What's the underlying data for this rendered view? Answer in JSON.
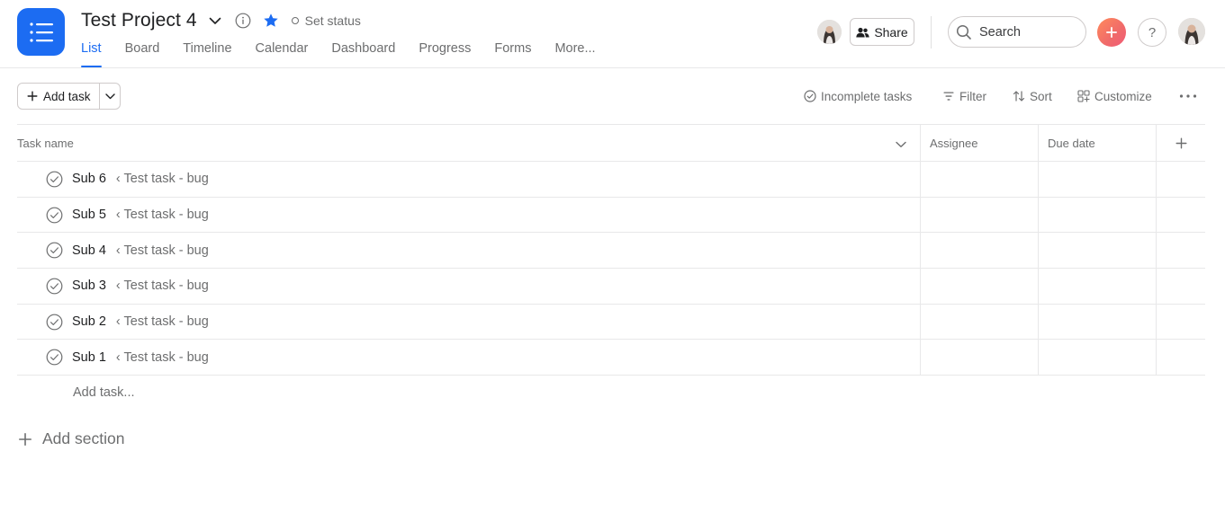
{
  "project": {
    "title": "Test Project 4",
    "set_status_label": "Set status"
  },
  "tabs": [
    {
      "label": "List",
      "active": true
    },
    {
      "label": "Board",
      "active": false
    },
    {
      "label": "Timeline",
      "active": false
    },
    {
      "label": "Calendar",
      "active": false
    },
    {
      "label": "Dashboard",
      "active": false
    },
    {
      "label": "Progress",
      "active": false
    },
    {
      "label": "Forms",
      "active": false
    },
    {
      "label": "More...",
      "active": false
    }
  ],
  "header": {
    "share_label": "Share",
    "search_placeholder": "Search",
    "help_label": "?"
  },
  "toolbar": {
    "add_task_label": "Add task",
    "incomplete_label": "Incomplete tasks",
    "filter_label": "Filter",
    "sort_label": "Sort",
    "customize_label": "Customize"
  },
  "table": {
    "columns": {
      "task_name": "Task name",
      "assignee": "Assignee",
      "due_date": "Due date"
    },
    "rows": [
      {
        "name": "Sub 6",
        "parent": "‹ Test task - bug"
      },
      {
        "name": "Sub 5",
        "parent": "‹ Test task - bug"
      },
      {
        "name": "Sub 4",
        "parent": "‹ Test task - bug"
      },
      {
        "name": "Sub 3",
        "parent": "‹ Test task - bug"
      },
      {
        "name": "Sub 2",
        "parent": "‹ Test task - bug"
      },
      {
        "name": "Sub 1",
        "parent": "‹ Test task - bug"
      }
    ],
    "add_task_inline": "Add task...",
    "add_section_label": "Add section"
  },
  "colors": {
    "accent": "#1c6cf2",
    "text_primary": "#1e1f21",
    "text_secondary": "#6d6e6f",
    "border": "#e8e8e9"
  }
}
